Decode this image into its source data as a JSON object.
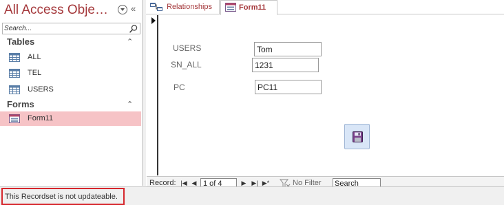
{
  "nav": {
    "title": "All Access Obje…",
    "search_placeholder": "Search...",
    "groups": [
      {
        "label": "Tables",
        "items": [
          {
            "label": "ALL",
            "icon": "table-icon"
          },
          {
            "label": "TEL",
            "icon": "table-icon"
          },
          {
            "label": "USERS",
            "icon": "table-icon"
          }
        ]
      },
      {
        "label": "Forms",
        "items": [
          {
            "label": "Form11",
            "icon": "form-icon",
            "selected": true
          }
        ]
      }
    ]
  },
  "tabs": [
    {
      "label": "Relationships",
      "icon": "relationships-icon"
    },
    {
      "label": "Form11",
      "icon": "form-icon",
      "active": true
    }
  ],
  "form": {
    "fields": [
      {
        "label": "USERS",
        "value": "Tom"
      },
      {
        "label": "SN_ALL",
        "value": "1231"
      },
      {
        "label": "PC",
        "value": "PC11"
      }
    ],
    "save_button_icon": "save-icon"
  },
  "record_nav": {
    "label": "Record:",
    "current": "1 of 4",
    "filter_label": "No Filter",
    "search_placeholder": "Search"
  },
  "status": {
    "message": "This Recordset is not updateable."
  },
  "colors": {
    "accent": "#a4373a",
    "selected_item_bg": "#f6c3c6",
    "status_highlight": "#d6262c",
    "save_button_bg": "#d9e6f7"
  }
}
